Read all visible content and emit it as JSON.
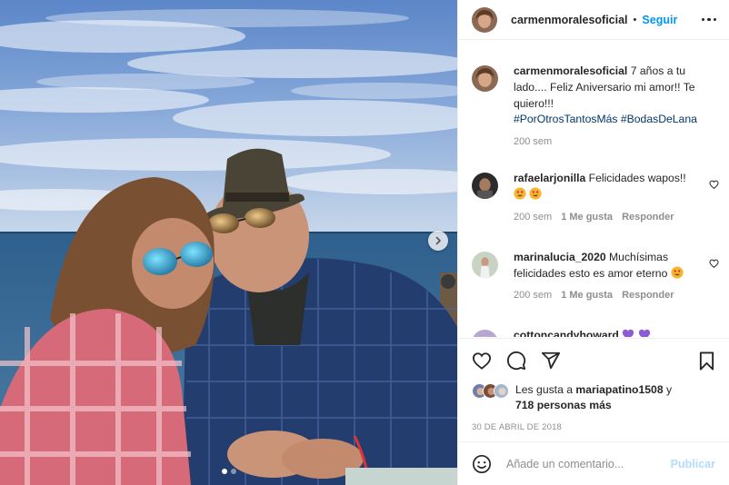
{
  "post": {
    "username": "carmenmoralesoficial",
    "follow_label": "Seguir",
    "separator": "•",
    "caption": {
      "text": "7 años a tu lado.... Feliz Aniversario mi amor!! Te quiero!!!",
      "hashtags": "#PorOtrosTantosMás #BodasDeLana",
      "time": "200 sem"
    },
    "comments": [
      {
        "username": "rafaelarjonilla",
        "text": "Felicidades wapos!!",
        "emoji": [
          "heart-eyes",
          "heart-eyes"
        ],
        "time": "200 sem",
        "likes": "1 Me gusta",
        "reply": "Responder"
      },
      {
        "username": "marinalucia_2020",
        "text": "Muchísimas felicidades esto es amor eterno",
        "emoji": [
          "heart-eyes"
        ],
        "time": "200 sem",
        "likes": "1 Me gusta",
        "reply": "Responder"
      },
      {
        "username": "cottoncandyhoward",
        "text": "",
        "emoji": [
          "purple-heart",
          "purple-heart"
        ]
      }
    ],
    "liked_by": {
      "prefix": "Les gusta a",
      "user": "mariapatino1508",
      "conjunction": "y",
      "others": "718 personas más"
    },
    "date": "30 DE ABRIL DE 2018",
    "add_comment_placeholder": "Añade un comentario...",
    "publish_label": "Publicar",
    "carousel": {
      "slides": 2,
      "active": 1
    }
  },
  "colors": {
    "link_blue": "#0095f6",
    "publish_disabled": "#b3dbff",
    "muted": "#8e8e8e",
    "text": "#262626",
    "hashtag": "#00376b"
  }
}
